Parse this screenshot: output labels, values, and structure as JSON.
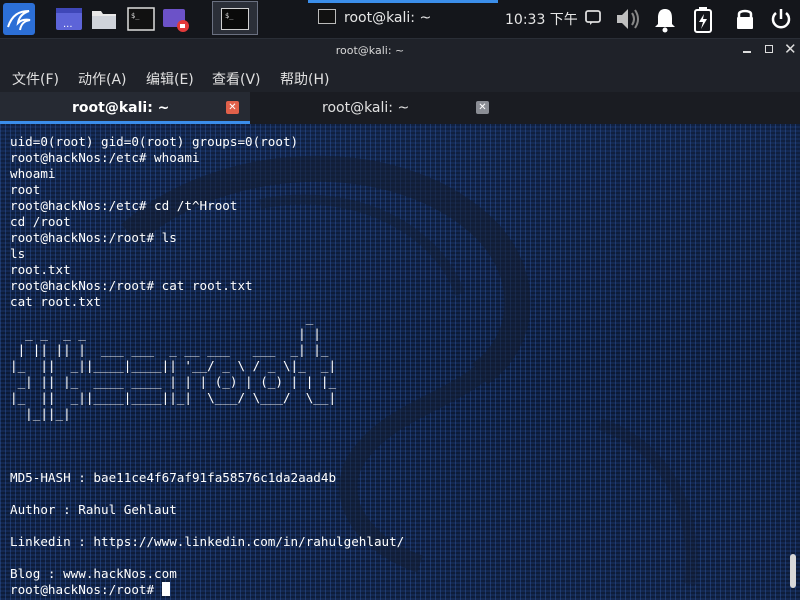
{
  "window": {
    "panel_title": "root@kali: ~",
    "title": "root@kali: ~"
  },
  "clock": "10:33 下午",
  "menu": [
    "文件(F)",
    "动作(A)",
    "编辑(E)",
    "查看(V)",
    "帮助(H)"
  ],
  "tabs": [
    {
      "label": "root@kali: ~",
      "active": true
    },
    {
      "label": "root@kali: ~",
      "active": false
    }
  ],
  "terminal_lines": [
    "uid=0(root) gid=0(root) groups=0(root)",
    "root@hackNos:/etc# whoami",
    "whoami",
    "root",
    "root@hackNos:/etc# cd /t^Hroot",
    "cd /root",
    "root@hackNos:/root# ls",
    "ls",
    "root.txt",
    "root@hackNos:/root# cat root.txt",
    "cat root.txt",
    "                                       _",
    "  _ _  _ _                            | |",
    " | || || |  ___ ___  _ __ ___   ___  _| |_",
    "|_  ||  _||____|____|| '__/ _ \\ / _ \\|_  _|",
    " _| || |_  ____ ____ | | | (_) | (_) | | |_",
    "|_  ||  _||____|____||_|  \\___/ \\___/  \\__|",
    "  |_||_|",
    "",
    "",
    "",
    "MD5-HASH : bae11ce4f67af91fa58576c1da2aad4b",
    "",
    "Author : Rahul Gehlaut",
    "",
    "Linkedin : https://www.linkedin.com/in/rahulgehlaut/",
    "",
    "Blog : www.hackNos.com"
  ],
  "prompt": "root@hackNos:/root# ",
  "colors": {
    "accent": "#3b8eea",
    "tab_close_active": "#e0604a",
    "panel_bg": "#14161b",
    "terminal_fg": "#ffffff"
  }
}
